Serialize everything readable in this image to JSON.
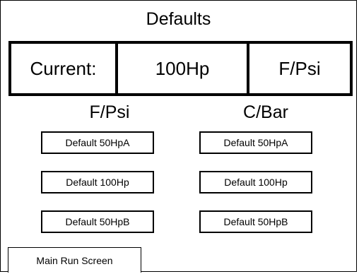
{
  "title": "Defaults",
  "current": {
    "label": "Current:",
    "horsepower": "100Hp",
    "units": "F/Psi"
  },
  "columns": {
    "left": {
      "heading": "F/Psi",
      "buttons": [
        "Default 50HpA",
        "Default 100Hp",
        "Default 50HpB"
      ]
    },
    "right": {
      "heading": "C/Bar",
      "buttons": [
        "Default 50HpA",
        "Default 100Hp",
        "Default 50HpB"
      ]
    }
  },
  "footer": {
    "main_run_label": "Main Run Screen"
  }
}
